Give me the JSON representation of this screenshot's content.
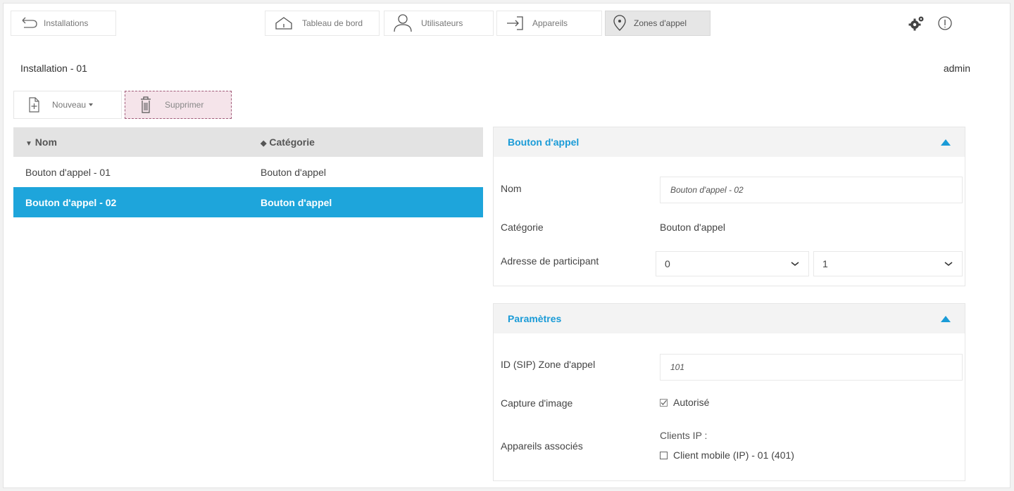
{
  "nav": {
    "back_label": "Installations",
    "tabs": [
      {
        "label": "Tableau de bord",
        "icon": "home-icon"
      },
      {
        "label": "Utilisateurs",
        "icon": "user-icon"
      },
      {
        "label": "Appareils",
        "icon": "device-icon"
      },
      {
        "label": "Zones d'appel",
        "icon": "location-pin-icon",
        "active": true
      }
    ],
    "settings_icon": "gears-icon",
    "info_icon": "info-icon"
  },
  "page": {
    "installation_title": "Installation - 01",
    "user": "admin"
  },
  "toolbar": {
    "new_label": "Nouveau",
    "delete_label": "Supprimer"
  },
  "table": {
    "columns": [
      "Nom",
      "Catégorie"
    ],
    "rows": [
      {
        "nom": "Bouton d'appel - 01",
        "categorie": "Bouton d'appel",
        "selected": false
      },
      {
        "nom": "Bouton d'appel - 02",
        "categorie": "Bouton d'appel",
        "selected": true
      }
    ]
  },
  "detail": {
    "title": "Bouton d'appel",
    "nom_label": "Nom",
    "nom_value": "Bouton d'appel - 02",
    "categorie_label": "Catégorie",
    "categorie_value": "Bouton d'appel",
    "adresse_label": "Adresse de participant",
    "adresse_value_1": "0",
    "adresse_value_2": "1"
  },
  "params": {
    "title": "Paramètres",
    "sip_label": "ID (SIP) Zone d'appel",
    "sip_value": "101",
    "capture_label": "Capture d'image",
    "capture_option": "Autorisé",
    "capture_checked": true,
    "devices_label": "Appareils associés",
    "clients_heading": "Clients IP :",
    "client_option": "Client mobile (IP) - 01 (401)",
    "client_checked": false
  },
  "colors": {
    "accent": "#1a9bd7",
    "selected_row": "#1ea5db",
    "delete_bg": "#f5e4ea"
  }
}
